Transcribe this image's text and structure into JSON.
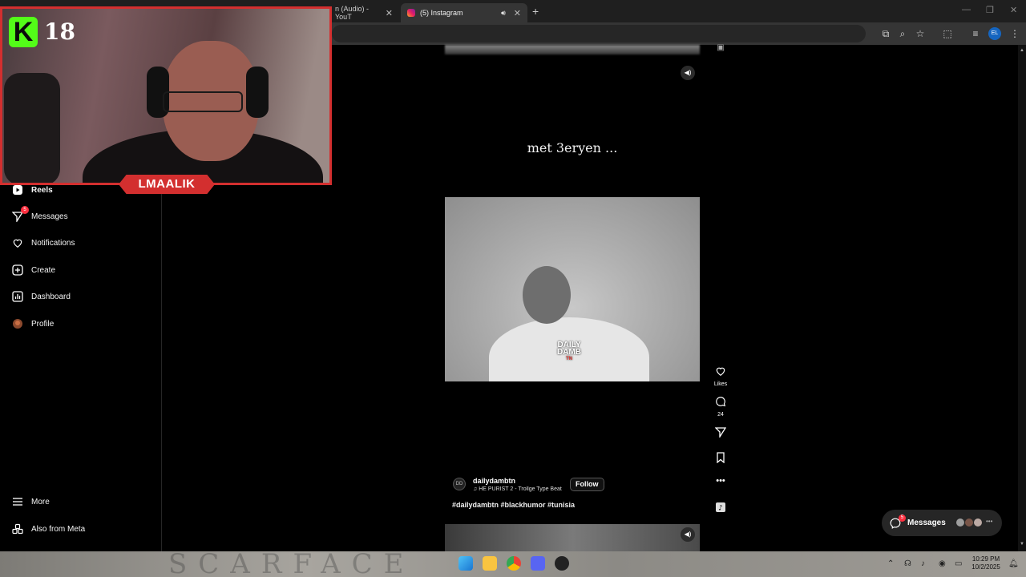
{
  "browser": {
    "tabs": [
      {
        "label": "n (Audio) - YouT",
        "active": false
      },
      {
        "label": "(5) Instagram",
        "active": true
      }
    ],
    "profile_initials": "EL"
  },
  "stream_overlay": {
    "logo_letter": "K",
    "logo_number": "18",
    "streamer_name": "LMAALIK"
  },
  "sidebar": {
    "items": [
      {
        "label": "Reels",
        "icon": "reels-icon",
        "bold": true
      },
      {
        "label": "Messages",
        "icon": "messages-icon",
        "badge": "5"
      },
      {
        "label": "Notifications",
        "icon": "heart-icon"
      },
      {
        "label": "Create",
        "icon": "plus-square-icon"
      },
      {
        "label": "Dashboard",
        "icon": "dashboard-icon"
      },
      {
        "label": "Profile",
        "icon": "profile-avatar"
      }
    ],
    "bottom_items": [
      {
        "label": "More",
        "icon": "menu-icon"
      },
      {
        "label": "Also from Meta",
        "icon": "meta-apps-icon"
      }
    ]
  },
  "reel": {
    "caption": "met 3eryen ...",
    "watermark": {
      "line1": "DAILY",
      "line2": "DAMB",
      "line3": "TN"
    },
    "author": "dailydambtn",
    "audio": "HE PURIST 2 - Trollge Type Beat",
    "follow_label": "Follow",
    "hashtags": "#dailydambtn #blackhumor #tunisia",
    "actions": {
      "likes_label": "Likes",
      "comments_count": "24"
    }
  },
  "messages_float": {
    "label": "Messages",
    "badge": "5"
  },
  "taskbar": {
    "time": "10:29 PM",
    "date": "10/2/2025",
    "wallpaper_text": "SCARFACE"
  },
  "colors": {
    "accent_red": "#d32f2f",
    "kick_green": "#53fc18",
    "ig_badge": "#ff3040"
  }
}
